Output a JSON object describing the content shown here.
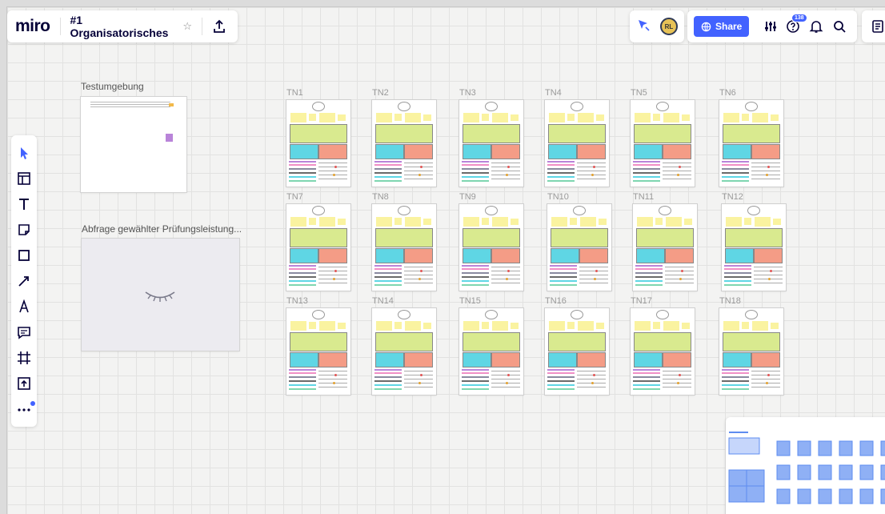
{
  "app": {
    "logo": "miro",
    "board_title": "#1 Organisatorisches",
    "star_icon": "star-icon",
    "export_icon": "upload-icon"
  },
  "presence": {
    "cursor_icon": "cursor-follow-icon",
    "avatar_initials": "RL"
  },
  "header": {
    "share_label": "Share",
    "share_icon": "globe-icon",
    "settings_icon": "sliders-icon",
    "help_icon": "help-icon",
    "help_badge": "138",
    "bell_icon": "bell-icon",
    "search_icon": "search-icon",
    "notes_icon": "notes-icon"
  },
  "toolbar": {
    "tools": [
      "select-tool",
      "templates-tool",
      "text-tool",
      "sticky-note-tool",
      "shape-tool",
      "connection-line-tool",
      "pen-tool",
      "comment-tool",
      "frame-tool",
      "upload-tool",
      "more-tools"
    ]
  },
  "frames": {
    "test": {
      "label": "Testumgebung"
    },
    "exam": {
      "label": "Abfrage gewählter Prüfungsleistung..."
    }
  },
  "participants": [
    "TN1",
    "TN2",
    "TN3",
    "TN4",
    "TN5",
    "TN6",
    "TN7",
    "TN8",
    "TN9",
    "TN10",
    "TN11",
    "TN12",
    "TN13",
    "TN14",
    "TN15",
    "TN16",
    "TN17",
    "TN18"
  ],
  "colors": {
    "accent": "#4262ff",
    "sticky_yellow": "#faf3a0",
    "sticky_green": "#d9ea8f",
    "sticky_cyan": "#5fd6e4",
    "sticky_salmon": "#f49c86",
    "sticky_purple": "#b984d9"
  }
}
